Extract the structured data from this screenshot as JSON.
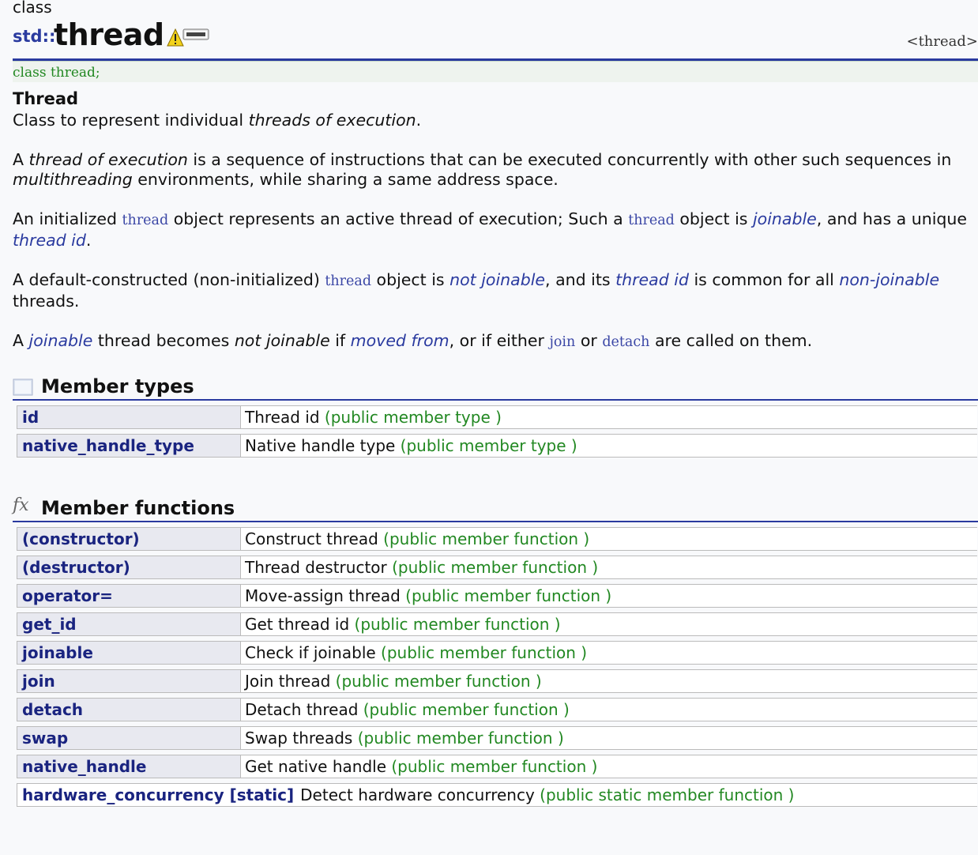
{
  "page": {
    "kind": "class",
    "namespace": "std::",
    "name": "thread",
    "header_link": "<thread>",
    "declaration": "class thread;",
    "short_title": "Thread"
  },
  "paragraphs": {
    "p1": {
      "a": "Class to represent individual ",
      "b": "threads of execution",
      "c": "."
    },
    "p2": {
      "a": "A ",
      "b": "thread of execution",
      "c": " is a sequence of instructions that can be executed concurrently with other such sequences in ",
      "d": "multithreading",
      "e": " environments, while sharing a same address space."
    },
    "p3": {
      "a": "An initialized ",
      "b": "thread",
      "c": " object represents an active thread of execution; Such a ",
      "d": "thread",
      "e": " object is ",
      "f": "joinable",
      "g": ", and has a unique ",
      "h": "thread id",
      "i": "."
    },
    "p4": {
      "a": "A default-constructed (non-initialized) ",
      "b": "thread",
      "c": " object is ",
      "d": "not joinable",
      "e": ", and its ",
      "f": "thread id",
      "g": " is common for all ",
      "h": "non-joinable",
      "i": " threads."
    },
    "p5": {
      "a": "A ",
      "b": "joinable",
      "c": " thread becomes ",
      "d": "not joinable",
      "e": " if ",
      "f": "moved from",
      "g": ", or if either ",
      "h": "join",
      "i": " or ",
      "j": "detach",
      "k": " are called on them."
    }
  },
  "member_types": {
    "heading": "Member types",
    "rows": [
      {
        "name": "id",
        "desc": "Thread id",
        "kind": "(public member type )"
      },
      {
        "name": "native_handle_type",
        "desc": "Native handle type",
        "kind": "(public member type )"
      }
    ]
  },
  "member_functions": {
    "heading": "Member functions",
    "icon": "fx",
    "rows": [
      {
        "name": "(constructor)",
        "desc": "Construct thread",
        "kind": "(public member function )"
      },
      {
        "name": "(destructor)",
        "desc": "Thread destructor",
        "kind": "(public member function )"
      },
      {
        "name": "operator=",
        "desc": "Move-assign thread",
        "kind": "(public member function )"
      },
      {
        "name": "get_id",
        "desc": "Get thread id",
        "kind": "(public member function )"
      },
      {
        "name": "joinable",
        "desc": "Check if joinable",
        "kind": "(public member function )"
      },
      {
        "name": "join",
        "desc": "Join thread",
        "kind": "(public member function )"
      },
      {
        "name": "detach",
        "desc": "Detach thread",
        "kind": "(public member function )"
      },
      {
        "name": "swap",
        "desc": "Swap threads",
        "kind": "(public member function )"
      },
      {
        "name": "native_handle",
        "desc": "Get native handle",
        "kind": "(public member function )"
      }
    ],
    "static_row": {
      "name": "hardware_concurrency [static]",
      "desc": "Detect hardware concurrency",
      "kind": "(public static member function )"
    }
  },
  "colors": {
    "link": "#2a3a9f",
    "kind": "#228822",
    "name_bg": "#e8e9f0"
  }
}
